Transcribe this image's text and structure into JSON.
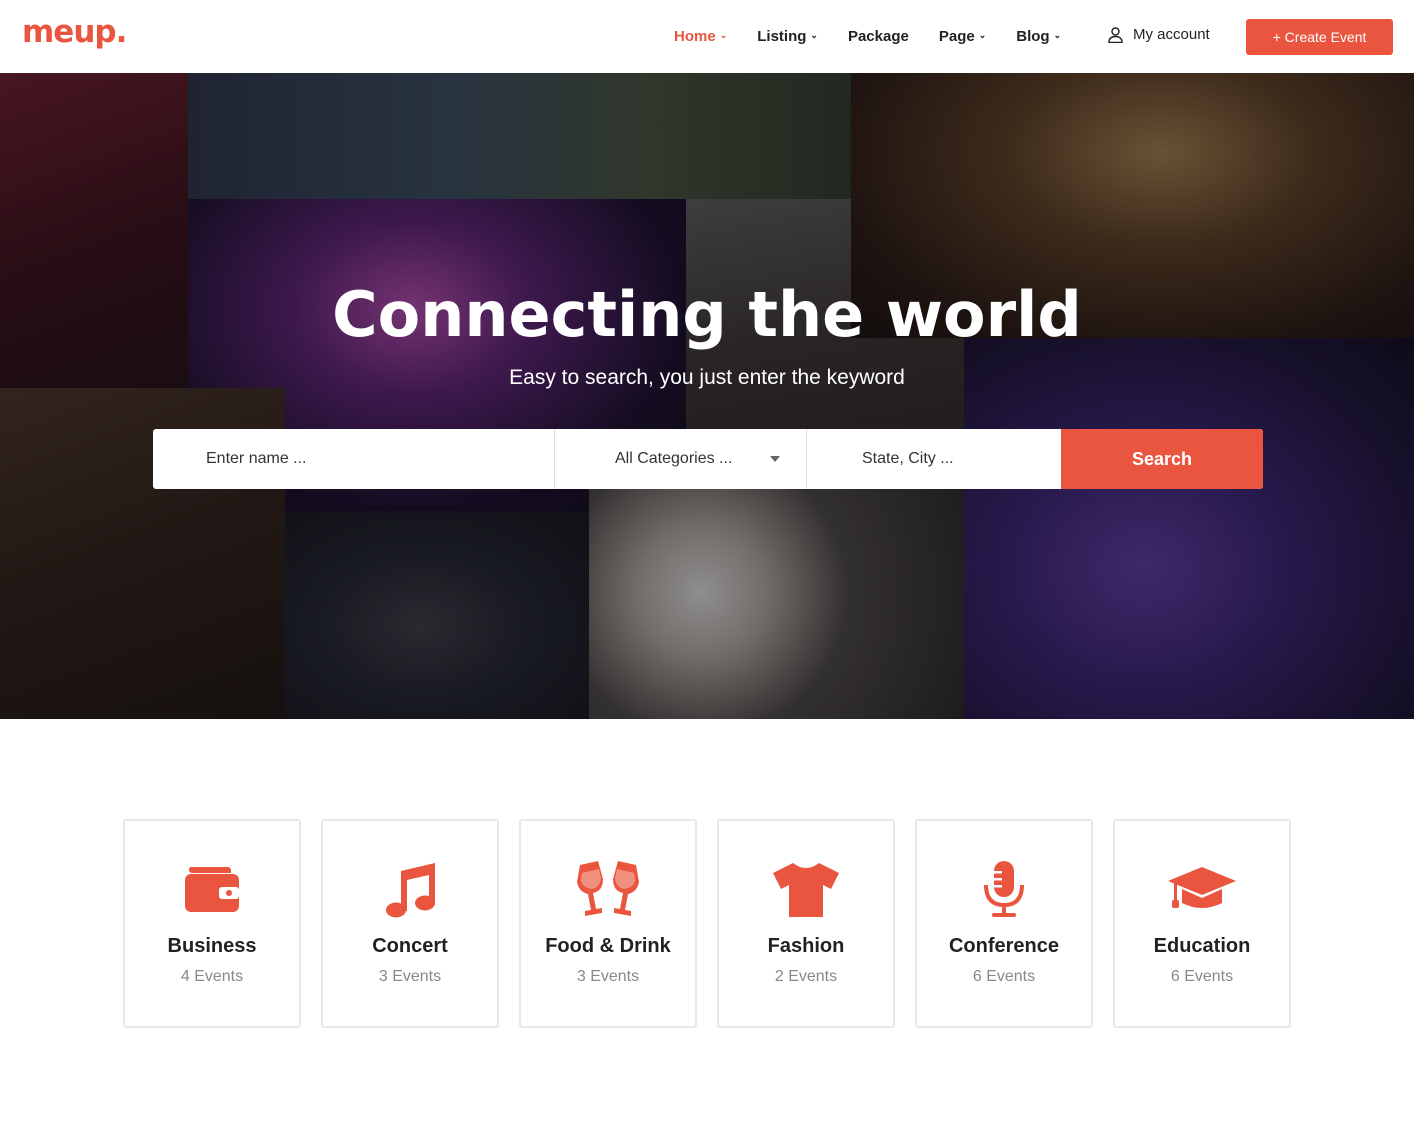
{
  "header": {
    "logo": "meup.",
    "nav": [
      {
        "label": "Home",
        "chevron": true,
        "active": true
      },
      {
        "label": "Listing",
        "chevron": true,
        "active": false
      },
      {
        "label": "Package",
        "chevron": false,
        "active": false
      },
      {
        "label": "Page",
        "chevron": true,
        "active": false
      },
      {
        "label": "Blog",
        "chevron": true,
        "active": false
      }
    ],
    "account_label": "My account",
    "create_event_label": "+ Create Event"
  },
  "hero": {
    "title": "Connecting the world",
    "subtitle": "Easy to search, you just enter the keyword"
  },
  "search": {
    "name_placeholder": "Enter name ...",
    "category_value": "All Categories ...",
    "city_placeholder": "State, City ...",
    "button_label": "Search"
  },
  "categories": [
    {
      "name": "Business",
      "count": "4 Events",
      "icon": "wallet-icon"
    },
    {
      "name": "Concert",
      "count": "3 Events",
      "icon": "music-note-icon"
    },
    {
      "name": "Food & Drink",
      "count": "3 Events",
      "icon": "wine-glasses-icon"
    },
    {
      "name": "Fashion",
      "count": "2 Events",
      "icon": "t-shirt-icon"
    },
    {
      "name": "Conference",
      "count": "6 Events",
      "icon": "microphone-icon"
    },
    {
      "name": "Education",
      "count": "6 Events",
      "icon": "graduation-cap-icon"
    }
  ],
  "colors": {
    "accent": "#e9553e",
    "text": "#222222",
    "muted": "#888888"
  }
}
